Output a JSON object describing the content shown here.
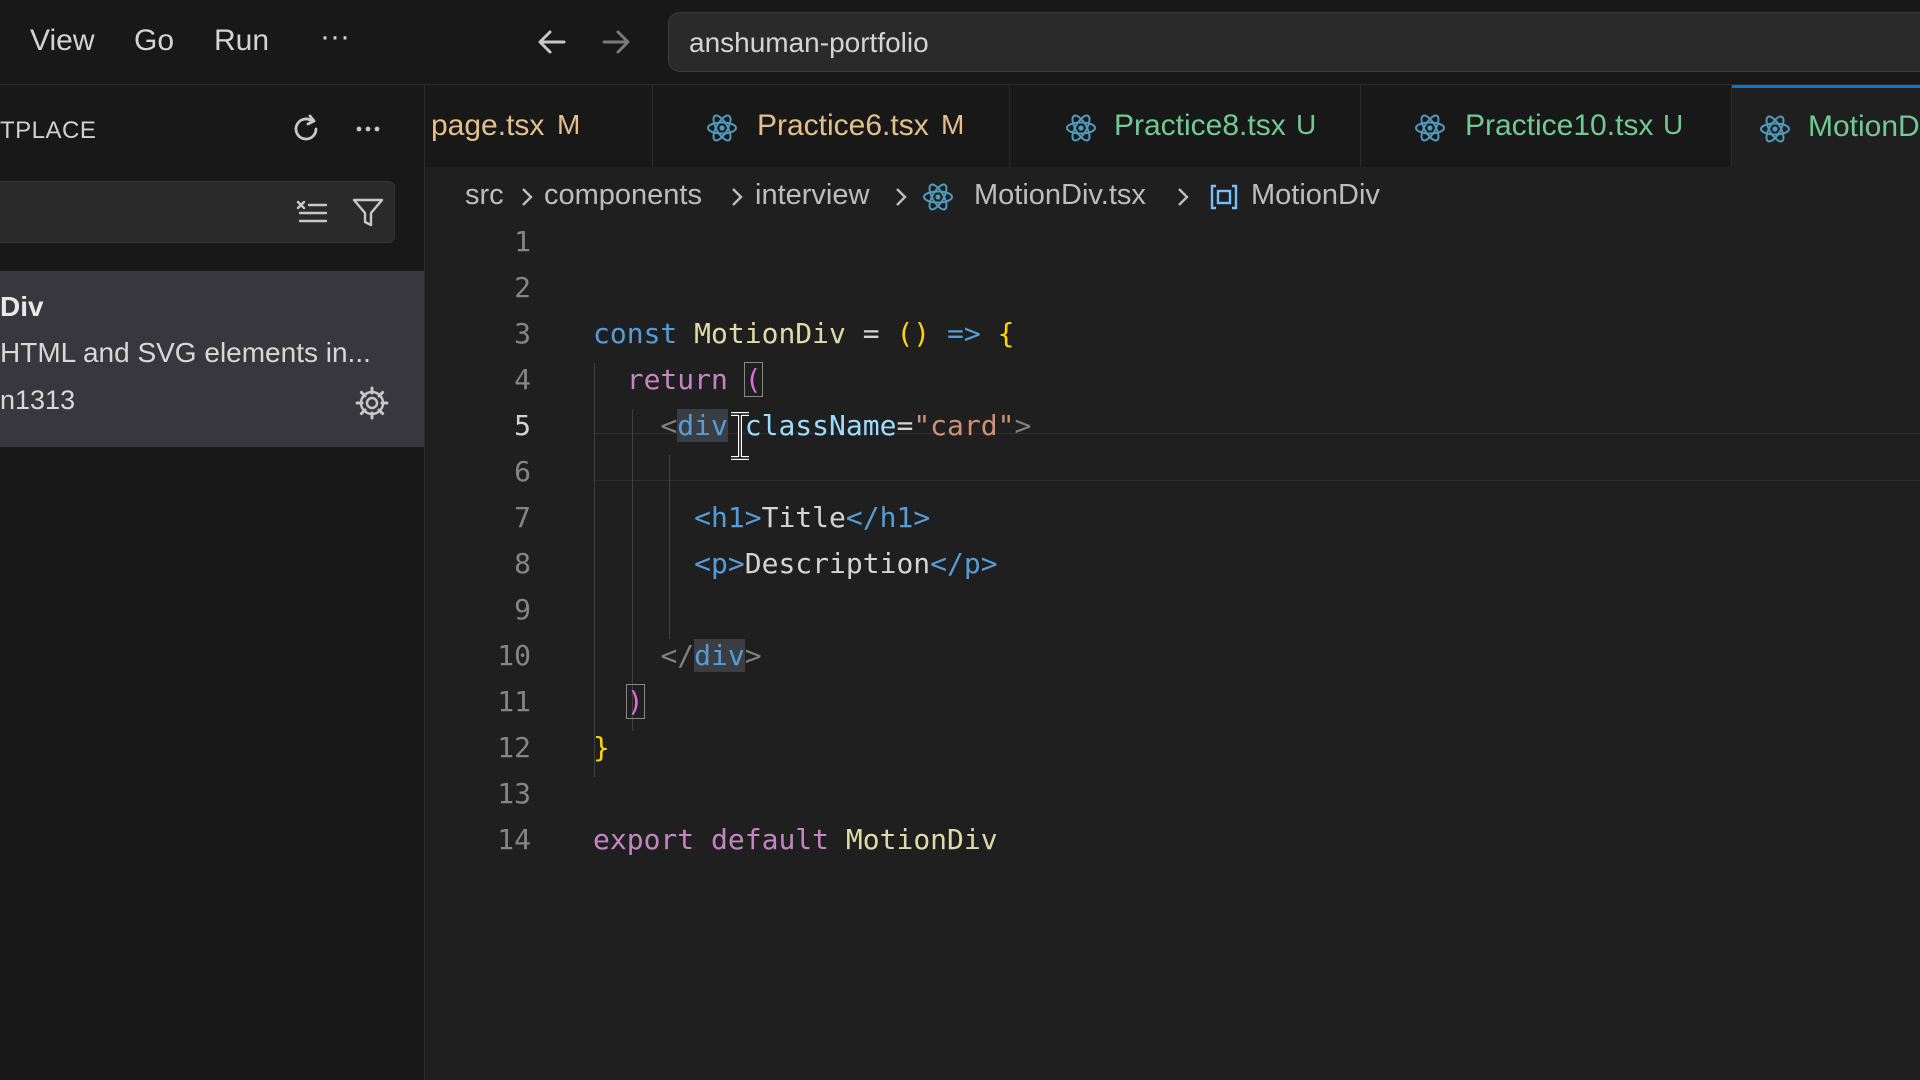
{
  "menu": {
    "view": "View",
    "go": "Go",
    "run": "Run",
    "more": "···"
  },
  "search": {
    "value": "anshuman-portfolio"
  },
  "sidebar": {
    "title": "TPLACE",
    "extension": {
      "name": "Div",
      "description": "HTML and SVG elements in...",
      "publisher": "n1313"
    }
  },
  "tabs": [
    {
      "label": "page.tsx",
      "status": "M",
      "color": "#e2c08d"
    },
    {
      "label": "Practice6.tsx",
      "status": "M",
      "color": "#e2c08d"
    },
    {
      "label": "Practice8.tsx",
      "status": "U",
      "color": "#73c991"
    },
    {
      "label": "Practice10.tsx",
      "status": "U",
      "color": "#73c991"
    },
    {
      "label": "MotionD",
      "status": "",
      "color": "#73c991"
    }
  ],
  "breadcrumb": [
    "src",
    "components",
    "interview",
    "MotionDiv.tsx",
    "MotionDiv"
  ],
  "editor": {
    "line_numbers": [
      "1",
      "2",
      "3",
      "4",
      "5",
      "6",
      "7",
      "8",
      "9",
      "10",
      "11",
      "12",
      "13",
      "14"
    ],
    "current_line": "5",
    "code": {
      "l3": {
        "const": "const",
        "name": "MotionDiv",
        "eq": " = ",
        "parens": "()",
        "arrow": " => ",
        "brace": "{"
      },
      "l4": {
        "return": "return",
        "paren": "("
      },
      "l5": {
        "lt": "<",
        "tag": "div",
        "attr": "className",
        "eq": "=",
        "val": "\"card\"",
        "gt": ">"
      },
      "l7": {
        "open": "<h1>",
        "text": "Title",
        "close": "</h1>"
      },
      "l8": {
        "open": "<p>",
        "text": "Description",
        "close": "</p>"
      },
      "l10": {
        "lt": "</",
        "tag": "div",
        "gt": ">"
      },
      "l11": {
        "paren": ")"
      },
      "l12": {
        "brace": "}"
      },
      "l14": {
        "export": "export",
        "default": "default",
        "name": "MotionDiv"
      }
    }
  },
  "colors": {
    "accent": "#0078d4",
    "modified": "#e2c08d",
    "untracked": "#73c991",
    "react_icon": "#519aba"
  }
}
